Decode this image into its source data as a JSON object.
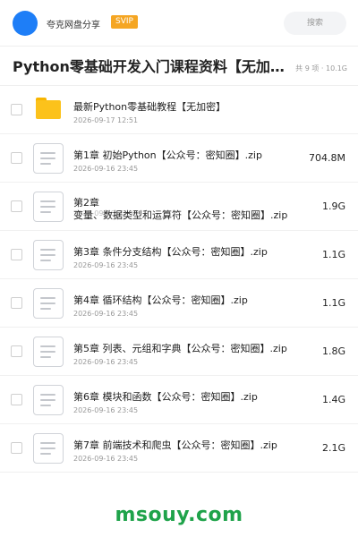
{
  "header": {
    "site_name": "夸克网盘分享",
    "badge": "SVIP",
    "search_placeholder": "搜索"
  },
  "title_bar": {
    "title": "Python零基础开发入门课程资料【无加密】、",
    "meta": "共 9 项 · 10.1G"
  },
  "files": [
    {
      "type": "folder",
      "name": "最新Python零基础教程【无加密】",
      "date": "2026-09-17 12:51",
      "size": ""
    },
    {
      "type": "file",
      "name": "第1章 初始Python【公众号：密知圈】.zip",
      "date": "2026-09-16 23:45",
      "size": "704.8M"
    },
    {
      "type": "file",
      "name_line1": "第2章",
      "name_line2": "变量、数据类型和运算符【公众号：密知圈】.zip",
      "date": "2026-09-16 23:45",
      "size": "1.9G"
    },
    {
      "type": "file",
      "name": "第3章 条件分支结构【公众号：密知圈】.zip",
      "date": "2026-09-16 23:45",
      "size": "1.1G"
    },
    {
      "type": "file",
      "name": "第4章 循环结构【公众号：密知圈】.zip",
      "date": "2026-09-16 23:45",
      "size": "1.1G"
    },
    {
      "type": "file",
      "name": "第5章 列表、元组和字典【公众号：密知圈】.zip",
      "date": "2026-09-16 23:45",
      "size": "1.8G"
    },
    {
      "type": "file",
      "name": "第6章 模块和函数【公众号：密知圈】.zip",
      "date": "2026-09-16 23:45",
      "size": "1.4G"
    },
    {
      "type": "file",
      "name": "第7章 前端技术和爬虫【公众号：密知圈】.zip",
      "date": "2026-09-16 23:45",
      "size": "2.1G"
    }
  ],
  "watermark": "msouy.com",
  "colors": {
    "accent": "#1e7ef7",
    "badge": "#f5a623",
    "folder": "#fcc21b",
    "watermark": "#1fa34a"
  }
}
